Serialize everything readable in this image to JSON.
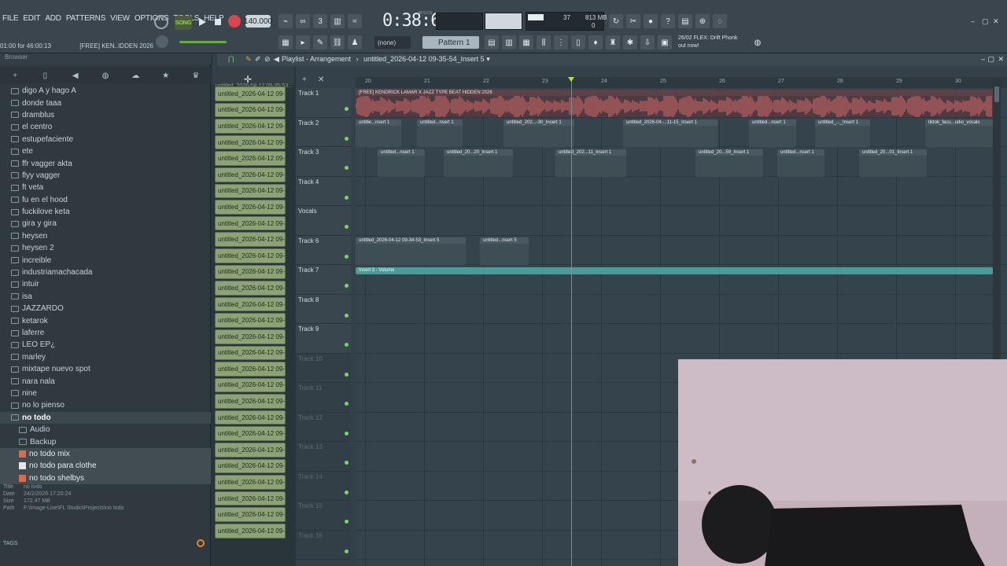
{
  "menu": [
    "FILE",
    "EDIT",
    "ADD",
    "PATTERNS",
    "VIEW",
    "OPTIONS",
    "TOOLS",
    "HELP"
  ],
  "hint": {
    "position": "01:00 for 46:00:13",
    "project": "[FREE] KEN..IDDEN 2026"
  },
  "transport": {
    "mode": "SONG",
    "tempo": "140.000",
    "time": "0:38:60",
    "time_unit": "M:S:CS"
  },
  "monitor": {
    "cpu": "37",
    "memory": "813 MB",
    "polyphony": "0"
  },
  "pattern_selector": {
    "snap": "(none)",
    "pattern": "Pattern 1"
  },
  "news": {
    "line1": "26/02 FLEX: Drift Phonk",
    "line2": "out now!"
  },
  "browser": {
    "title": "Browser",
    "tab_icons": [
      "plus-icon",
      "file-icon",
      "back-icon",
      "globe-icon",
      "cloud-icon",
      "star-icon",
      "crown-icon"
    ],
    "folders": [
      "digo A y hago A",
      "donde taaa",
      "dramblus",
      "el centro",
      "estupefaciente",
      "ete",
      "ffr vagger akta",
      "flyy vagger",
      "ft veta",
      "fu en el hood",
      "fuckilove keta",
      "gira y gira",
      "heysen",
      "heysen 2",
      "increible",
      "industriamachacada",
      "intuir",
      "isa",
      "JAZZARDO",
      "ketarok",
      "laferre",
      "LEO EP¿",
      "marley",
      "mixtape nuevo spot",
      "nara nala",
      "nine",
      "no lo pienso"
    ],
    "open_folder": "no todo",
    "subfolders": [
      "Audio",
      "Backup"
    ],
    "files": [
      "no todo mix",
      "no todo para clothe",
      "no todo shelbys"
    ],
    "info": {
      "title_label": "Title",
      "title": "no todo",
      "date_label": "Date",
      "date": "24/2/2026 17:20:24",
      "size_label": "Size",
      "size": "172.47 MB",
      "path_label": "Path",
      "path": "F:\\Image-Line\\FL Studio\\Projects\\no todo"
    },
    "tags_label": "TAGS"
  },
  "picker": {
    "top_item": "untitled_2026-04-12 09-35-53...",
    "clip_label": "untitled_2026-04-12 09-...",
    "clip_count": 28
  },
  "playlist": {
    "title": "Playlist - Arrangement",
    "arrangement": "untitled_2026-04-12 09-35-54_Insert 5",
    "ruler": [
      "20",
      "21",
      "22",
      "23",
      "24",
      "25",
      "26",
      "27",
      "28",
      "29",
      "30"
    ],
    "tracks": [
      "Track 1",
      "Track 2",
      "Track 3",
      "Track 4",
      "Vocals",
      "Track 6",
      "Track 7",
      "Track 8",
      "Track 9",
      "Track 10",
      "Track 11",
      "Track 12",
      "Track 13",
      "Track 14",
      "Track 15",
      "Track 16"
    ],
    "clips": {
      "t1": "[FREE] KENDRICK LAMAR X JAZZ TYPE BEAT HIDDEN  2026",
      "t2a": "untitle...nsert 1",
      "t2b": "untitled...nsert 1",
      "t2c": "untitled_202...-30_Insert 1",
      "t2d": "untitled_2026-04-...11-15_Insert 1",
      "t2e": "untitled...nsert 1",
      "t2f": "untitled_..._Insert 1",
      "t2g": "tiktok_facu...udio_vocals",
      "t3a": "untitled...nsert 1",
      "t3b": "untitled_20...20_Insert 1",
      "t3c": "untitled_202...11_Insert 1",
      "t3d": "untitled_20...59_Insert 1",
      "t3e": "untitled...nsert 1",
      "t3f": "untitled_20...01_Insert 1",
      "t6a": "untitled_2026-04-12 09-34-53_Insert 5",
      "t6b": "untitled...nsert 5",
      "t7": "Insert 3 - Volume"
    }
  },
  "colors": {
    "accent": "#f2a030",
    "clip_green": "#8da277",
    "audio_red": "#d86a6a",
    "automation_teal": "#4f9a96"
  }
}
